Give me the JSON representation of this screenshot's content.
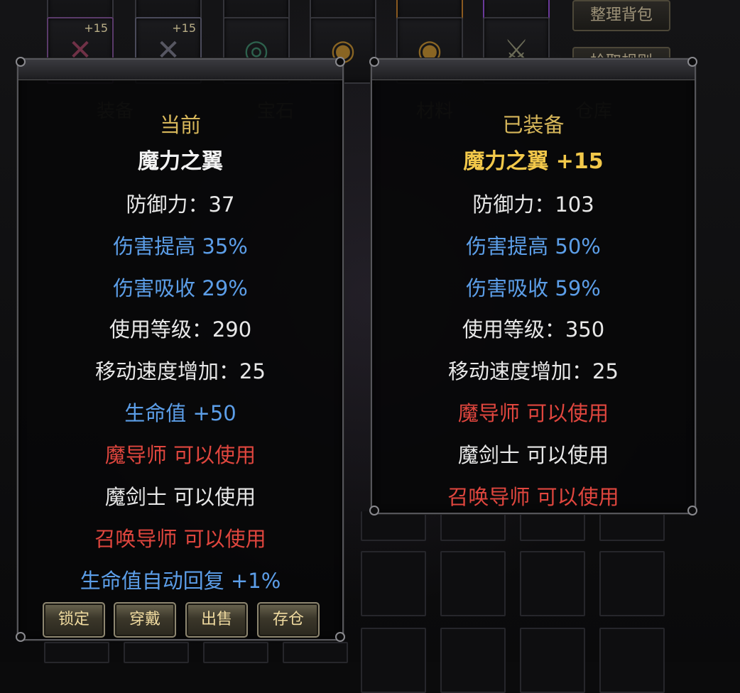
{
  "bag_buttons": {
    "sort": "整理背包",
    "pickup": "拾取规则"
  },
  "bg_tabs": {
    "equipment": "装备",
    "gems": "宝石",
    "materials": "材料",
    "warehouse": "仓库"
  },
  "top_slots": {
    "plus_a": "+15",
    "plus_b": "+15"
  },
  "current_panel": {
    "header": "当前",
    "item_name": "魔力之翼",
    "defense": "防御力：37",
    "damage_boost_label": "伤害提高",
    "damage_boost_value": "35%",
    "damage_absorb_label": "伤害吸收",
    "damage_absorb_value": "29%",
    "level_req": "使用等级：290",
    "move_speed": "移动速度增加：25",
    "hp_label": "生命值",
    "hp_value": "+50",
    "class_mage": "魔导师 可以使用",
    "class_sword": "魔剑士 可以使用",
    "class_summoner": "召唤导师 可以使用",
    "hp_regen_label": "生命值自动回复",
    "hp_regen_value": "+1%",
    "buttons": {
      "lock": "锁定",
      "wear": "穿戴",
      "sell": "出售",
      "store": "存仓"
    }
  },
  "equipped_panel": {
    "header": "已装备",
    "item_name": "魔力之翼 +15",
    "defense": "防御力：103",
    "damage_boost_label": "伤害提高",
    "damage_boost_value": "50%",
    "damage_absorb_label": "伤害吸收",
    "damage_absorb_value": "59%",
    "level_req": "使用等级：350",
    "move_speed": "移动速度增加：25",
    "class_mage": "魔导师 可以使用",
    "class_sword": "魔剑士 可以使用",
    "class_summoner": "召唤导师 可以使用"
  },
  "colors": {
    "header_gold": "#d6b65a",
    "legend_name": "#f2c84a",
    "stat_blue": "#5c9ee8",
    "class_red": "#e0463e",
    "button_text": "#f0dba0"
  },
  "icons": [
    "wing-item-icon",
    "ring-item-icon",
    "necklace-item-icon",
    "weapon-item-icon"
  ]
}
